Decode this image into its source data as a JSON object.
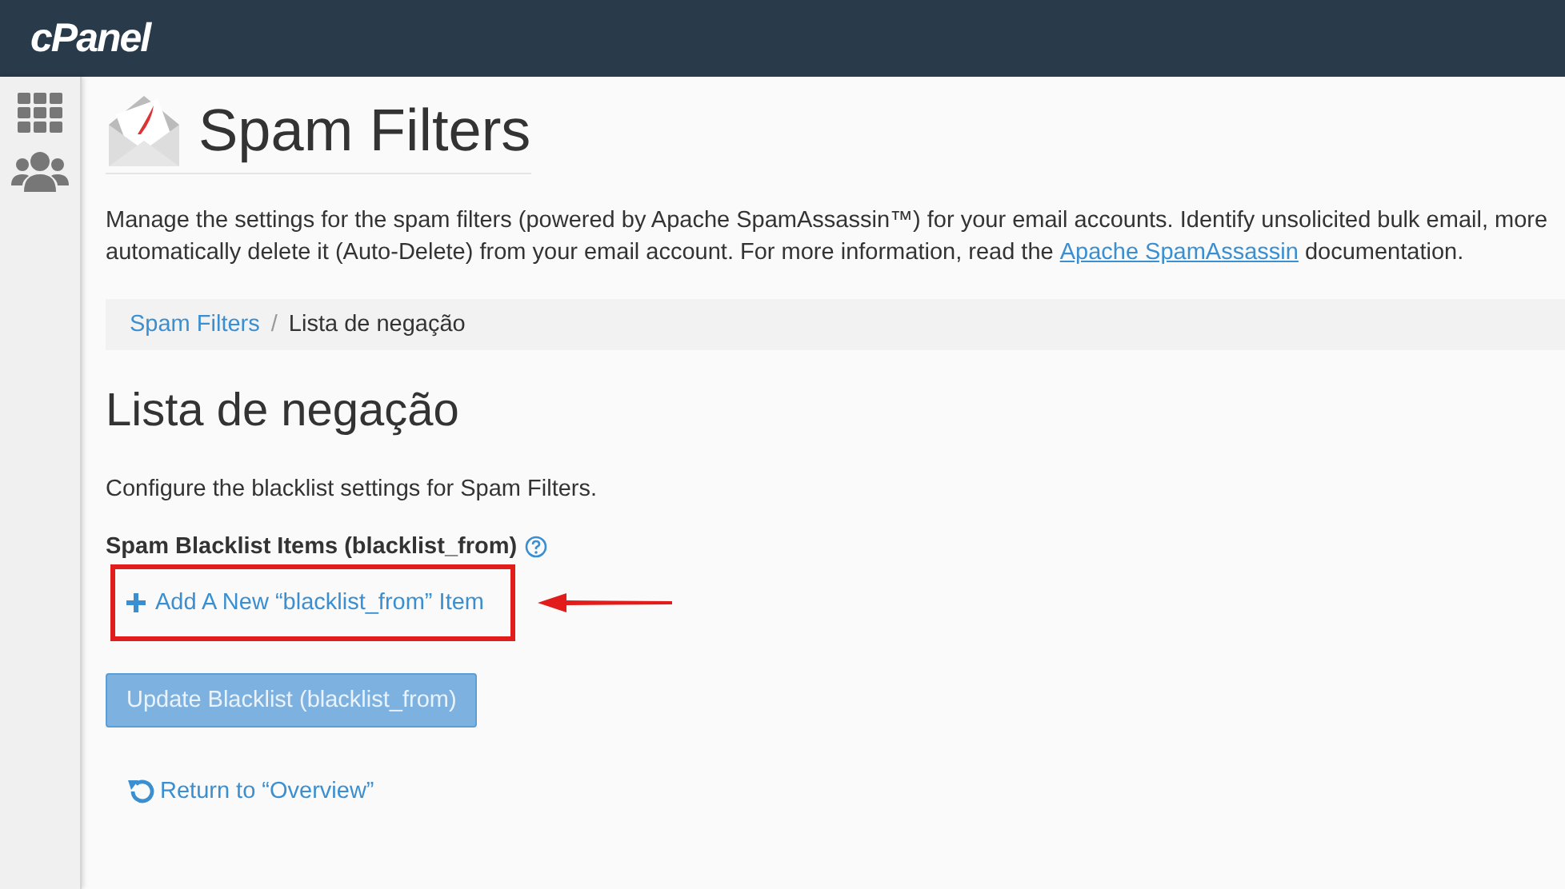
{
  "header": {
    "logo": "cPanel"
  },
  "sidebar": {
    "items": [
      {
        "kind": "grid",
        "selected": false
      },
      {
        "kind": "users",
        "selected": false
      }
    ]
  },
  "page": {
    "title": "Spam Filters",
    "description": {
      "line_1": "Manage the settings for the spam filters (powered by Apache SpamAssassin™) for your email accounts. Identify unsolicited bulk email, more",
      "line_2_before": "automatically delete it (Auto-Delete) from your email account. For more information, read the",
      "link": "Apache SpamAssassin",
      "line_2_after": "documentation."
    },
    "breadcrumb_separator": "/",
    "breadcrumb": [
      {
        "label": "Spam Filters",
        "link": true
      },
      {
        "label": "Lista de negação",
        "link": false
      }
    ],
    "section_title": "Lista de negação",
    "intro": "Configure the blacklist settings for Spam Filters.",
    "field_label": "Spam Blacklist Items (blacklist_from)",
    "add_link": "Add A New “blacklist_from” Item",
    "update_button": {
      "label": "Update Blacklist (blacklist_from)",
      "disabled": true
    },
    "return_link": "Return to “Overview”"
  }
}
